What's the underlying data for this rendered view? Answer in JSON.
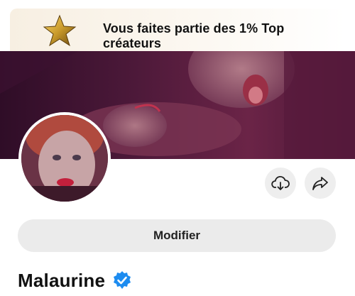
{
  "banner": {
    "icon": "gold-star-icon",
    "text": "Vous faites partie des 1% Top créateurs"
  },
  "cover": {
    "icon": "cover-photo"
  },
  "avatar": {
    "icon": "profile-photo"
  },
  "actions": {
    "download_icon": "cloud-download-icon",
    "share_icon": "share-arrow-icon"
  },
  "profile": {
    "edit_label": "Modifier",
    "name": "Malaurine",
    "verified_icon": "verified-badge-icon"
  },
  "colors": {
    "badge_blue": "#1d8cf0",
    "banner_bg": "#f7efe2",
    "button_bg": "#ebebeb"
  }
}
